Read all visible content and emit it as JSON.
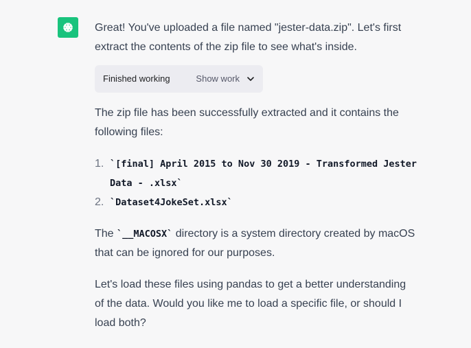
{
  "assistant": {
    "avatar_icon": "openai-logo-icon",
    "avatar_color": "#19c37d",
    "intro": "Great! You've uploaded a file named \"jester-data.zip\". Let's first extract the contents of the zip file to see what's inside.",
    "work": {
      "status": "Finished working",
      "toggle_label": "Show work"
    },
    "extracted": "The zip file has been successfully extracted and it contains the following files:",
    "files": [
      {
        "num": "1.",
        "name": "`[final] April 2015 to Nov 30 2019 - Transformed Jester Data - .xlsx`"
      },
      {
        "num": "2.",
        "name": "`Dataset4JokeSet.xlsx`"
      }
    ],
    "macosx_prefix": "The ",
    "macosx_code": "`__MACOSX`",
    "macosx_suffix": " directory is a system directory created by macOS that can be ignored for our purposes.",
    "closing": "Let's load these files using pandas to get a better understanding of the data. Would you like me to load a specific file, or should I load both?"
  }
}
